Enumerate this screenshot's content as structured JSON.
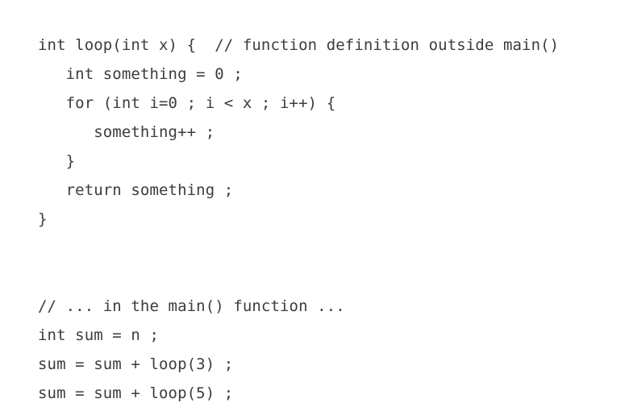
{
  "document": {
    "type": "code-snippet",
    "language": "c",
    "background_color": "#ffffff",
    "text_color": "#3b3b43",
    "font_size_px": 19,
    "line_height_px": 36,
    "indent_unit_spaces": 3
  },
  "code": {
    "lines": [
      {
        "id": "line-1",
        "indent": 0,
        "text": "int loop(int x) {  // function definition outside main()"
      },
      {
        "id": "line-2",
        "indent": 1,
        "text": "int something = 0 ;"
      },
      {
        "id": "line-3",
        "indent": 1,
        "text": "for (int i=0 ; i < x ; i++) {"
      },
      {
        "id": "line-4",
        "indent": 2,
        "text": "something++ ;"
      },
      {
        "id": "line-5",
        "indent": 1,
        "text": "}"
      },
      {
        "id": "line-6",
        "indent": 1,
        "text": "return something ;"
      },
      {
        "id": "line-7",
        "indent": 0,
        "text": "}"
      },
      {
        "id": "line-8",
        "indent": 0,
        "text": ""
      },
      {
        "id": "line-9",
        "indent": 0,
        "text": ""
      },
      {
        "id": "line-10",
        "indent": 0,
        "text": "// ... in the main() function ..."
      },
      {
        "id": "line-11",
        "indent": 0,
        "text": "int sum = n ;"
      },
      {
        "id": "line-12",
        "indent": 0,
        "text": "sum = sum + loop(3) ;"
      },
      {
        "id": "line-13",
        "indent": 0,
        "text": "sum = sum + loop(5) ;"
      }
    ]
  }
}
